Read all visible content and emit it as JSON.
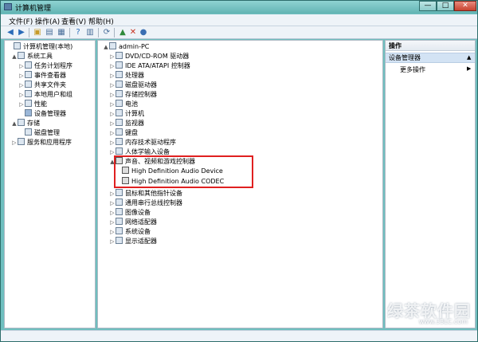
{
  "window": {
    "title": "计算机管理",
    "controls": {
      "minimize": "—",
      "maximize": "□",
      "close": "✕"
    }
  },
  "menu": [
    {
      "label": "文件(F)"
    },
    {
      "label": "操作(A)"
    },
    {
      "label": "查看(V)"
    },
    {
      "label": "帮助(H)"
    }
  ],
  "left_tree": [
    {
      "label": "计算机管理(本地)",
      "indent": 0,
      "exp": ""
    },
    {
      "label": "系统工具",
      "indent": 1,
      "exp": "▲"
    },
    {
      "label": "任务计划程序",
      "indent": 2,
      "exp": "▷"
    },
    {
      "label": "事件查看器",
      "indent": 2,
      "exp": "▷"
    },
    {
      "label": "共享文件夹",
      "indent": 2,
      "exp": "▷"
    },
    {
      "label": "本地用户和组",
      "indent": 2,
      "exp": "▷"
    },
    {
      "label": "性能",
      "indent": 2,
      "exp": "▷"
    },
    {
      "label": "设备管理器",
      "indent": 2,
      "exp": "",
      "selected": true
    },
    {
      "label": "存储",
      "indent": 1,
      "exp": "▲"
    },
    {
      "label": "磁盘管理",
      "indent": 2,
      "exp": ""
    },
    {
      "label": "服务和应用程序",
      "indent": 1,
      "exp": "▷"
    }
  ],
  "device_tree": {
    "root": "admin-PC",
    "items": [
      "DVD/CD-ROM 驱动器",
      "IDE ATA/ATAPI 控制器",
      "处理器",
      "磁盘驱动器",
      "存储控制器",
      "电池",
      "计算机",
      "监视器",
      "键盘",
      "内存技术驱动程序",
      "人体学输入设备"
    ],
    "expanded_category": "声音、视频和游戏控制器",
    "expanded_children": [
      "High Definition Audio Device",
      "High Definition Audio CODEC"
    ],
    "items_after": [
      "鼠标和其他指针设备",
      "通用串行总线控制器",
      "图像设备",
      "网络适配器",
      "系统设备",
      "显示适配器"
    ]
  },
  "actions": {
    "header": "操作",
    "section": "设备管理器",
    "more": "更多操作"
  },
  "watermark": {
    "main": "绿茶软件园",
    "sub": "www.33LC.com"
  }
}
